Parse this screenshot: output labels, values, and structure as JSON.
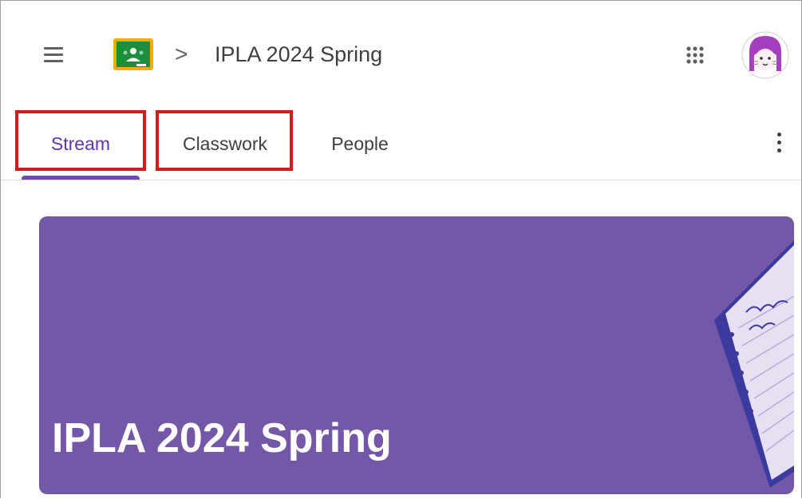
{
  "header": {
    "breadcrumb_separator": ">",
    "class_name": "IPLA 2024 Spring"
  },
  "tabs": [
    {
      "label": "Stream",
      "active": true
    },
    {
      "label": "Classwork",
      "active": false
    },
    {
      "label": "People",
      "active": false
    }
  ],
  "banner": {
    "title": "IPLA 2024 Spring",
    "color": "#7557a8"
  },
  "colors": {
    "active_tab": "#5e35b1",
    "highlight": "#cf1c1c",
    "logo_green": "#1e8e3e",
    "logo_yellow": "#f9ab00"
  },
  "icons": [
    "menu-icon",
    "google-classroom-logo-icon",
    "apps-grid-icon",
    "user-avatar-icon",
    "more-vert-icon"
  ]
}
